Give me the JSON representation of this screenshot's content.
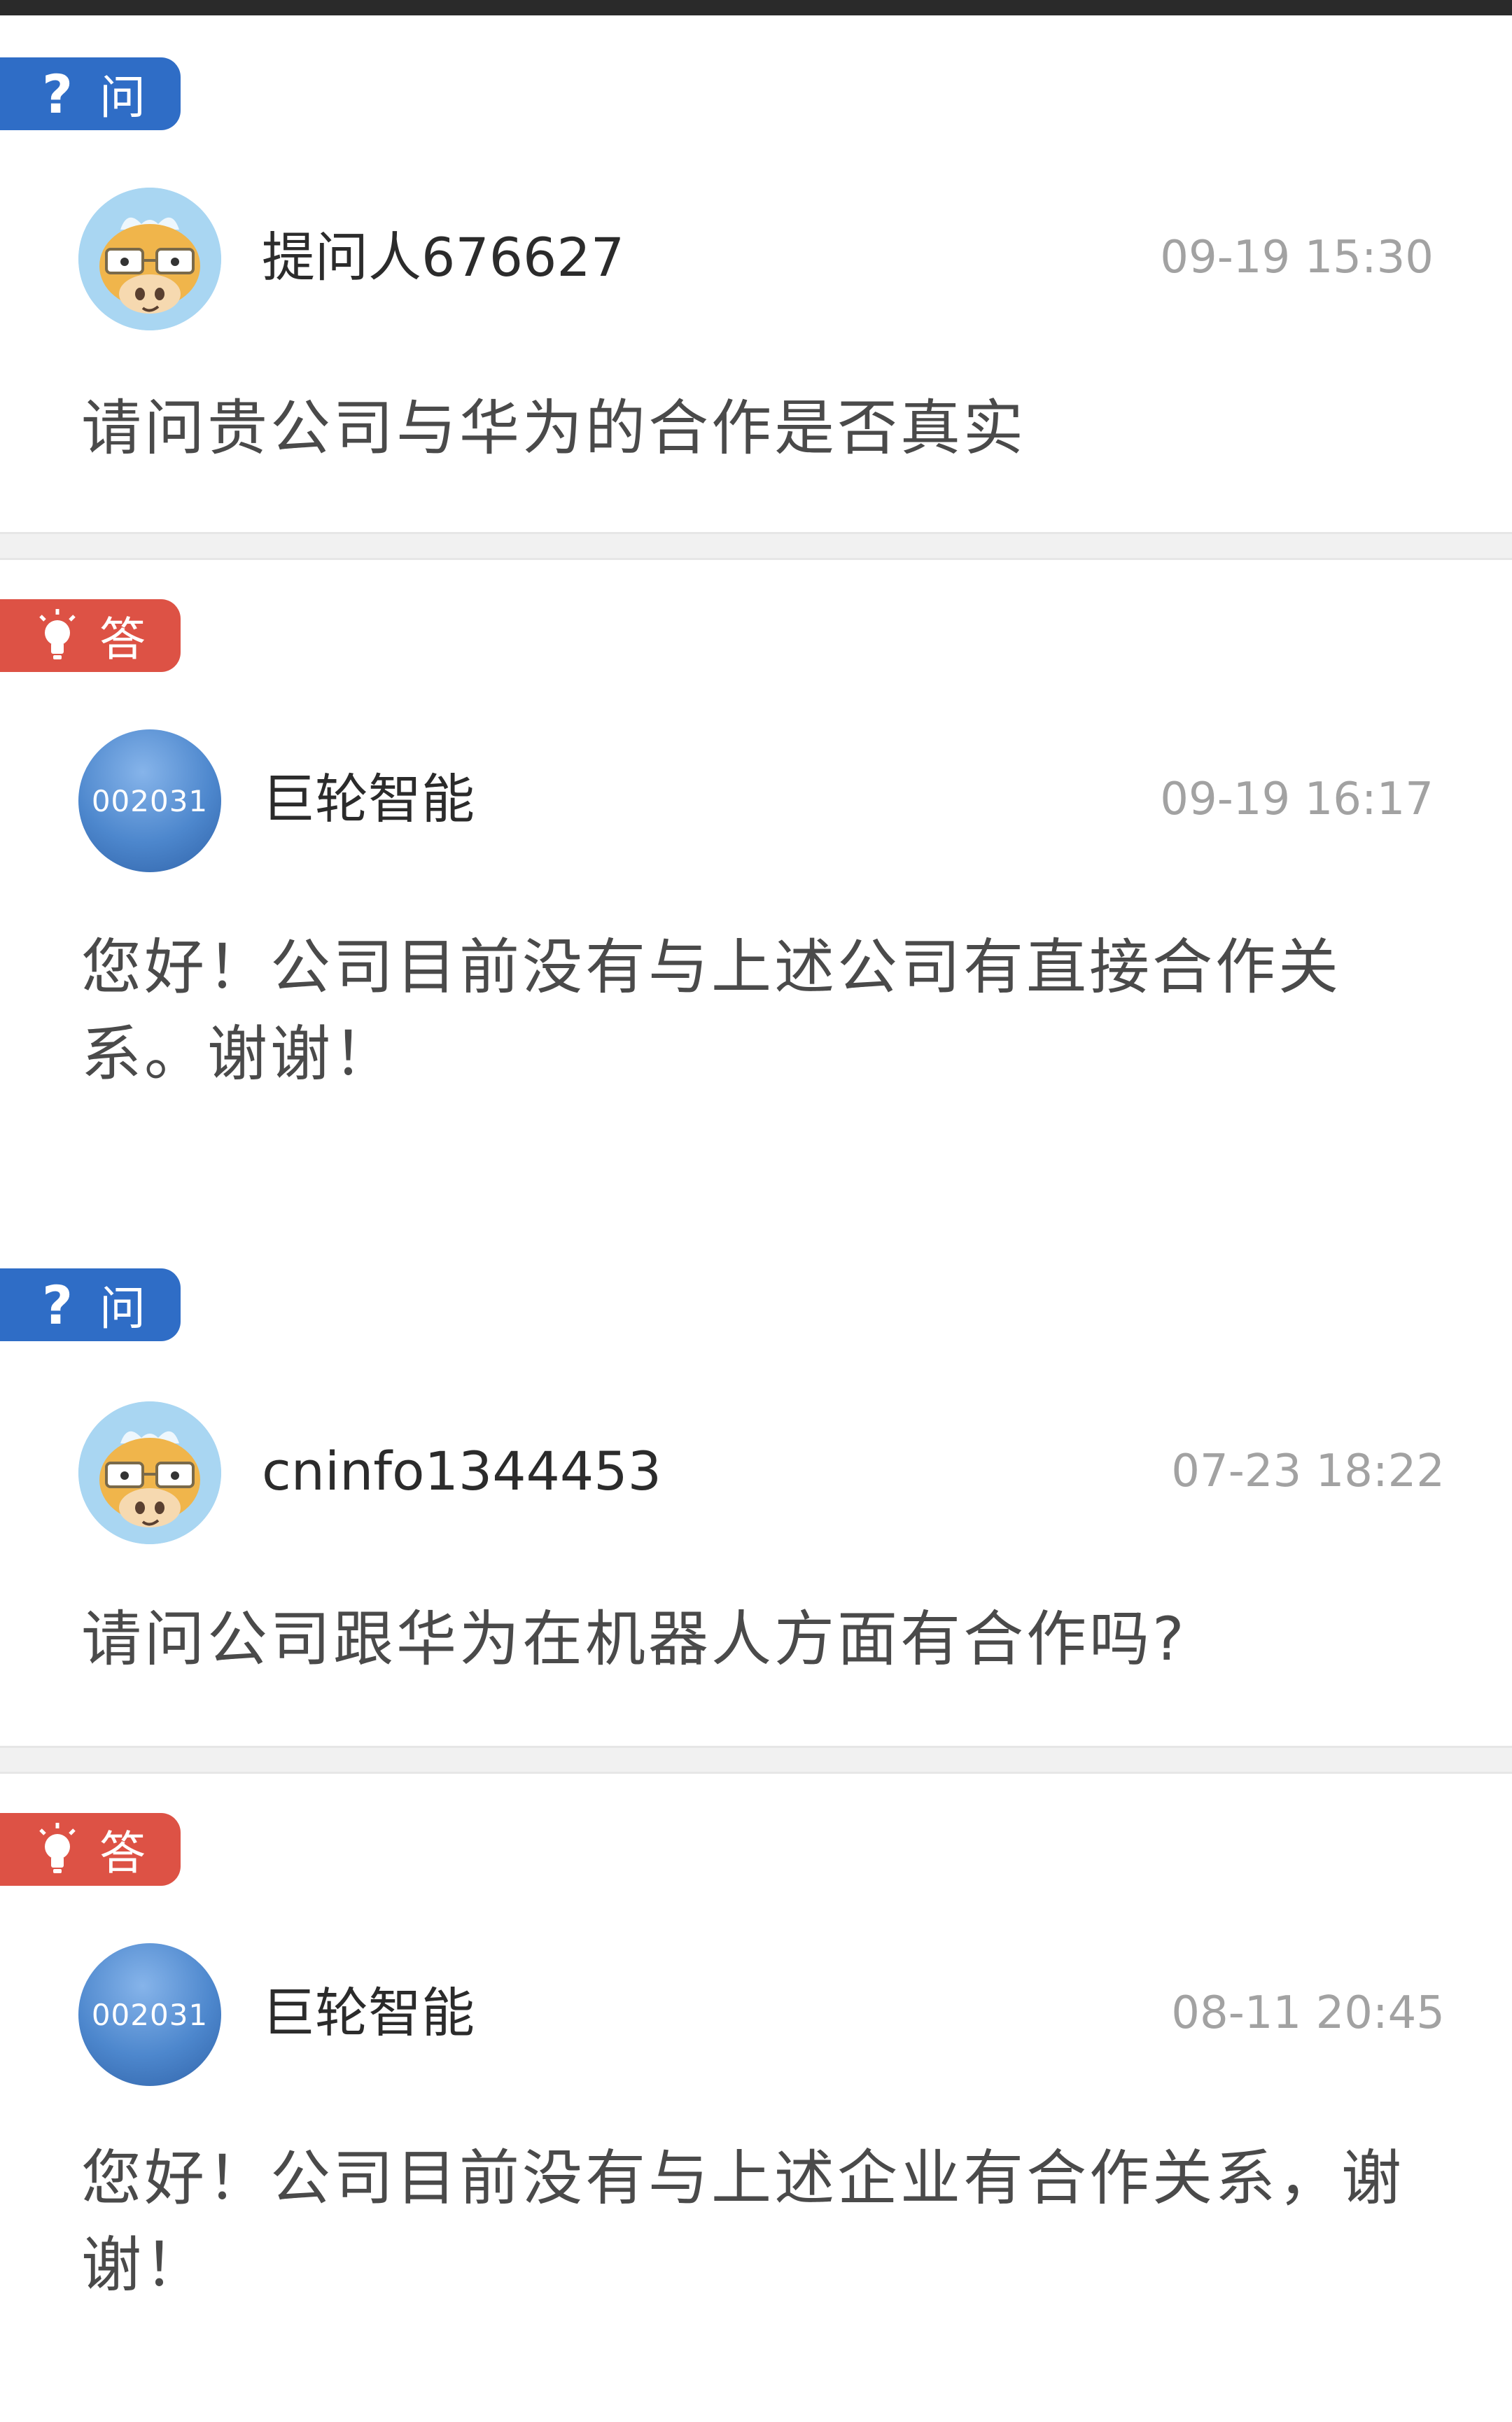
{
  "threads": [
    {
      "question": {
        "badge_label": "问",
        "user_name": "提问人676627",
        "time": "09-19 15:30",
        "text": "请问贵公司与华为的合作是否真实"
      },
      "answer": {
        "badge_label": "答",
        "avatar_code": "002031",
        "company_name": "巨轮智能",
        "time": "09-19 16:17",
        "text": "您好！公司目前没有与上述公司有直接合作关系。谢谢！"
      }
    },
    {
      "question": {
        "badge_label": "问",
        "user_name": "cninfo1344453",
        "time": "07-23 18:22",
        "text": "请问公司跟华为在机器人方面有合作吗?"
      },
      "answer": {
        "badge_label": "答",
        "avatar_code": "002031",
        "company_name": "巨轮智能",
        "time": "08-11 20:45",
        "text": "您好！公司目前没有与上述企业有合作关系，谢谢！"
      }
    }
  ],
  "colors": {
    "question_badge": "#2f6dc6",
    "answer_badge": "#dd5245",
    "time_text": "#a2a2a2",
    "divider": "#f1f1f1"
  },
  "icons": {
    "question": "question-mark-icon",
    "answer": "lightbulb-icon",
    "user_avatar": "cartoon-cow-avatar-icon"
  }
}
